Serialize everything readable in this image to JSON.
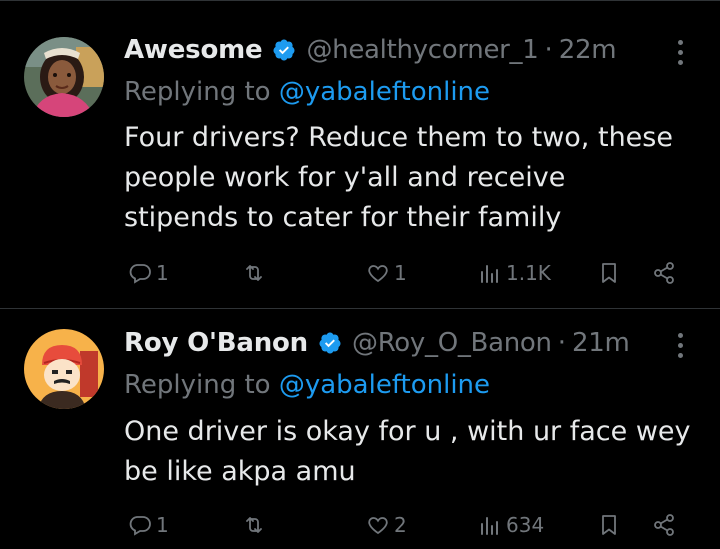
{
  "tweets": [
    {
      "name": "Awesome",
      "handle": "@healthycorner_1",
      "separator": "·",
      "time": "22m",
      "replying_prefix": "Replying to",
      "replying_to": "@yabaleftonline",
      "body_lines": [
        "Four drivers? Reduce them to two, these",
        "people work for y'all and receive",
        "stipends to cater for their family"
      ],
      "replies": "1",
      "retweets": "",
      "likes": "1",
      "views": "1.1K"
    },
    {
      "name": "Roy O'Banon",
      "handle": "@Roy_O_Banon",
      "separator": "·",
      "time": "21m",
      "replying_prefix": "Replying to",
      "replying_to": "@yabaleftonline",
      "body_lines": [
        "One driver is okay for u , with ur face wey",
        "be like akpa amu"
      ],
      "replies": "1",
      "retweets": "",
      "likes": "2",
      "views": "634"
    }
  ],
  "colors": {
    "background": "#000000",
    "text": "#e7e9ea",
    "muted": "#71767b",
    "accent": "#1d9bf0",
    "divider": "#2f3336"
  },
  "icons": [
    "verified-badge-icon",
    "more-icon",
    "reply-icon",
    "retweet-icon",
    "like-icon",
    "views-icon",
    "bookmark-icon",
    "share-icon"
  ]
}
